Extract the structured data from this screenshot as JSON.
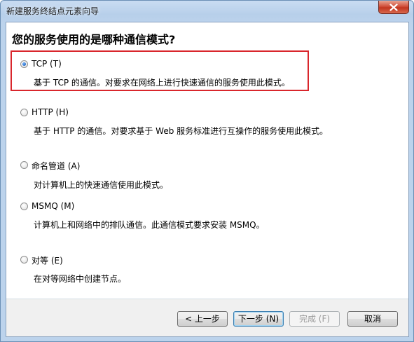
{
  "window": {
    "title": "新建服务终结点元素向导"
  },
  "page": {
    "heading": "您的服务使用的是哪种通信模式?"
  },
  "options": [
    {
      "label": "TCP (T)",
      "description": "基于 TCP 的通信。对要求在网络上进行快速通信的服务使用此模式。",
      "selected": true
    },
    {
      "label": "HTTP (H)",
      "description": "基于 HTTP 的通信。对要求基于 Web 服务标准进行互操作的服务使用此模式。",
      "selected": false
    },
    {
      "label": "命名管道 (A)",
      "description": "对计算机上的快速通信使用此模式。",
      "selected": false
    },
    {
      "label": "MSMQ (M)",
      "description": "计算机上和网络中的排队通信。此通信模式要求安装 MSMQ。",
      "selected": false
    },
    {
      "label": "对等 (E)",
      "description": "在对等网络中创建节点。",
      "selected": false
    }
  ],
  "buttons": {
    "back": "< 上一步",
    "next": "下一步 (N)",
    "finish": "完成 (F)",
    "cancel": "取消"
  },
  "colors": {
    "highlight": "#d9262c",
    "accent": "#1d5fb8"
  }
}
